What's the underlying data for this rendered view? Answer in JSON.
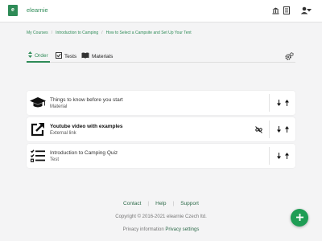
{
  "header": {
    "logo_letter": "e",
    "brand": "elearnie",
    "icons": [
      "institution-icon",
      "document-icon",
      "user-icon",
      "caret-down-icon"
    ]
  },
  "breadcrumb": [
    "My Courses",
    "Introduction to Camping",
    "How to Select a Campsite and Set Up Your Tent"
  ],
  "tabs": [
    {
      "label": "Order",
      "icon": "sort-icon",
      "active": true
    },
    {
      "label": "Tests",
      "icon": "checkbox-icon",
      "active": false
    },
    {
      "label": "Materials",
      "icon": "book-icon",
      "active": false
    }
  ],
  "items": [
    {
      "title": "Things to know before you start",
      "type": "Material",
      "icon": "graduation-cap-icon"
    },
    {
      "title": "Youtube video with examples",
      "type": "External link",
      "icon": "external-link-icon"
    },
    {
      "title": "Introduction to Camping Quiz",
      "type": "Test",
      "icon": "checklist-icon"
    }
  ],
  "footer": {
    "links": [
      "Contact",
      "Help",
      "Support"
    ],
    "separator": "|",
    "copyright": "Copyright © 2016-2021 elearnie Czech ltd.",
    "privacy_text": "Privacy information",
    "privacy_link": "Privacy settings"
  },
  "colors": {
    "accent": "#2e8b57",
    "fab": "#1f9d55"
  }
}
